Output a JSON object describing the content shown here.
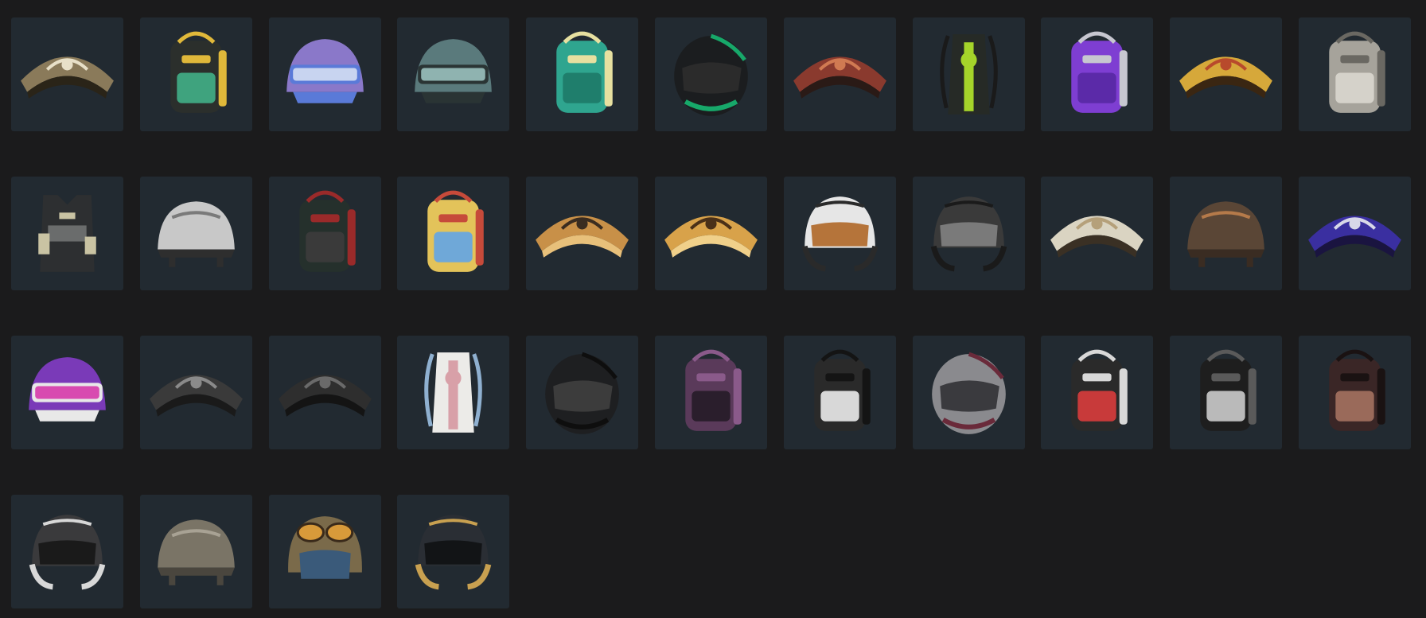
{
  "palette": {
    "page_background": "#1b1b1c",
    "tile_background": "#222a31"
  },
  "items": [
    {
      "kind": "parachute",
      "icon": "parachute-icon",
      "primary": "#8a7a5a",
      "secondary": "#e8e0c8",
      "accent": "#2a2418"
    },
    {
      "kind": "backpack",
      "icon": "backpack-icon",
      "primary": "#2b2f2c",
      "secondary": "#3fa37e",
      "accent": "#e0b83a"
    },
    {
      "kind": "helmet-visor",
      "icon": "helmet-icon",
      "primary": "#8a78c9",
      "secondary": "#c8d4f0",
      "accent": "#5a7ad8"
    },
    {
      "kind": "helmet-visor",
      "icon": "helmet-icon",
      "primary": "#5a7a7c",
      "secondary": "#8fb3b0",
      "accent": "#2a3434"
    },
    {
      "kind": "backpack",
      "icon": "backpack-icon",
      "primary": "#2fa58f",
      "secondary": "#1f7e6c",
      "accent": "#e7e0a0"
    },
    {
      "kind": "moto-helmet",
      "icon": "motorcycle-helmet-icon",
      "primary": "#1b1d1f",
      "secondary": "#17a86a",
      "accent": "#2b2b2b"
    },
    {
      "kind": "parachute",
      "icon": "parachute-icon",
      "primary": "#8a3a2e",
      "secondary": "#d07a52",
      "accent": "#2a1a16"
    },
    {
      "kind": "vest-pack",
      "icon": "backpack-icon",
      "primary": "#262a26",
      "secondary": "#a5d42a",
      "accent": "#1a1a1a"
    },
    {
      "kind": "backpack",
      "icon": "backpack-icon",
      "primary": "#7e3ed2",
      "secondary": "#5b2aa8",
      "accent": "#c7c7d0"
    },
    {
      "kind": "parachute",
      "icon": "parachute-icon",
      "primary": "#d6a83a",
      "secondary": "#b84a2c",
      "accent": "#3a2612"
    },
    {
      "kind": "backpack",
      "icon": "backpack-icon",
      "primary": "#a6a39b",
      "secondary": "#d5d2ca",
      "accent": "#6a6862"
    },
    {
      "kind": "vest",
      "icon": "vest-icon",
      "primary": "#2d2f31",
      "secondary": "#6a6c6c",
      "accent": "#c9c3a3"
    },
    {
      "kind": "helmet",
      "icon": "helmet-icon",
      "primary": "#c8c8c8",
      "secondary": "#2e2e2e",
      "accent": "#7a7a7a"
    },
    {
      "kind": "backpack",
      "icon": "backpack-icon",
      "primary": "#25302c",
      "secondary": "#3a3a3a",
      "accent": "#9a2a2a"
    },
    {
      "kind": "backpack",
      "icon": "backpack-icon",
      "primary": "#e3c35a",
      "secondary": "#6fa8d8",
      "accent": "#c64a3a"
    },
    {
      "kind": "parachute",
      "icon": "parachute-icon",
      "primary": "#c89048",
      "secondary": "#3a2c20",
      "accent": "#e8c07a"
    },
    {
      "kind": "parachute",
      "icon": "parachute-icon",
      "primary": "#d8a24a",
      "secondary": "#4a3018",
      "accent": "#f0d08a"
    },
    {
      "kind": "open-helmet",
      "icon": "motorcycle-helmet-icon",
      "primary": "#e6e6e6",
      "secondary": "#2a2a2a",
      "accent": "#b5743a"
    },
    {
      "kind": "open-helmet",
      "icon": "motorcycle-helmet-icon",
      "primary": "#3a3a3a",
      "secondary": "#1a1a1a",
      "accent": "#7a7a7a"
    },
    {
      "kind": "parachute",
      "icon": "parachute-icon",
      "primary": "#dad4c2",
      "secondary": "#b5a07a",
      "accent": "#3a3024"
    },
    {
      "kind": "helmet",
      "icon": "helmet-icon",
      "primary": "#5a4636",
      "secondary": "#3a2c22",
      "accent": "#b57a4a"
    },
    {
      "kind": "parachute",
      "icon": "parachute-icon",
      "primary": "#3a2fa0",
      "secondary": "#d8d8e8",
      "accent": "#1a1440"
    },
    {
      "kind": "helmet-visor",
      "icon": "helmet-icon",
      "primary": "#7a3ab8",
      "secondary": "#d84ab0",
      "accent": "#e8e8e8"
    },
    {
      "kind": "parachute",
      "icon": "parachute-icon",
      "primary": "#3a3a3a",
      "secondary": "#8a8a8a",
      "accent": "#1a1a1a"
    },
    {
      "kind": "parachute",
      "icon": "parachute-icon",
      "primary": "#2e2e2e",
      "secondary": "#6a6a6a",
      "accent": "#141414"
    },
    {
      "kind": "vest-pack",
      "icon": "backpack-icon",
      "primary": "#ecebe8",
      "secondary": "#d8a0a8",
      "accent": "#8fb0d0"
    },
    {
      "kind": "moto-helmet",
      "icon": "motorcycle-helmet-icon",
      "primary": "#1e1f21",
      "secondary": "#0e0e0e",
      "accent": "#3c3c3c"
    },
    {
      "kind": "backpack",
      "icon": "backpack-icon",
      "primary": "#5a3a5a",
      "secondary": "#2a1e2c",
      "accent": "#8a5a8a"
    },
    {
      "kind": "backpack",
      "icon": "backpack-icon",
      "primary": "#2a2a2a",
      "secondary": "#d8d8d8",
      "accent": "#141414"
    },
    {
      "kind": "moto-helmet",
      "icon": "motorcycle-helmet-icon",
      "primary": "#8a8a8e",
      "secondary": "#6a2a3a",
      "accent": "#3a3a3e"
    },
    {
      "kind": "backpack",
      "icon": "backpack-icon",
      "primary": "#2a2a2a",
      "secondary": "#c83a3a",
      "accent": "#d8d8d8"
    },
    {
      "kind": "backpack",
      "icon": "backpack-icon",
      "primary": "#1e1e1e",
      "secondary": "#bababa",
      "accent": "#5a5a5a"
    },
    {
      "kind": "backpack",
      "icon": "backpack-icon",
      "primary": "#3a2626",
      "secondary": "#9a6a5a",
      "accent": "#1a1212"
    },
    {
      "kind": "open-helmet",
      "icon": "motorcycle-helmet-icon",
      "primary": "#3a3a3c",
      "secondary": "#d8d8d8",
      "accent": "#1a1a1a"
    },
    {
      "kind": "helmet",
      "icon": "helmet-icon",
      "primary": "#7a7466",
      "secondary": "#4a463e",
      "accent": "#a8a294"
    },
    {
      "kind": "aviator-helmet",
      "icon": "helmet-icon",
      "primary": "#7a6a4a",
      "secondary": "#d89a3a",
      "accent": "#3a5a7a"
    },
    {
      "kind": "open-helmet",
      "icon": "motorcycle-helmet-icon",
      "primary": "#2a2e34",
      "secondary": "#c8a050",
      "accent": "#121416"
    }
  ]
}
